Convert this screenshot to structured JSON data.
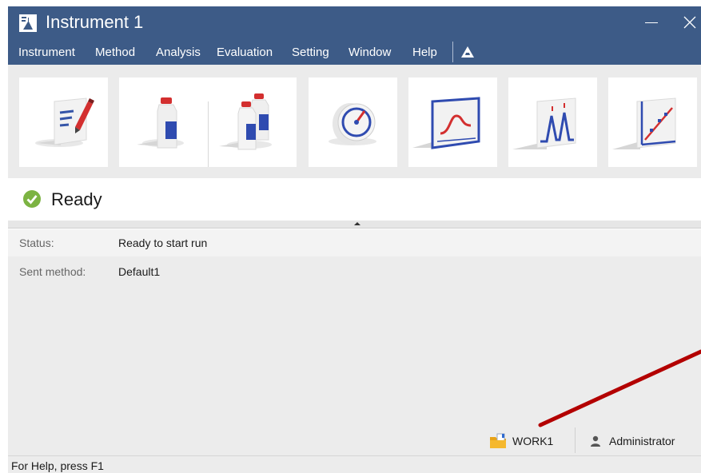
{
  "window": {
    "title": "Instrument 1"
  },
  "menu": {
    "items": [
      "Instrument",
      "Method",
      "Analysis",
      "Evaluation",
      "Setting",
      "Window",
      "Help"
    ]
  },
  "toolbar": {
    "buttons": [
      {
        "icon": "edit-document-icon"
      },
      {
        "icon": "single-sample-bottle-icon"
      },
      {
        "icon": "batch-bottles-icon"
      },
      {
        "icon": "gauge-icon"
      },
      {
        "icon": "data-monitor-icon"
      },
      {
        "icon": "chromatogram-peaks-icon"
      },
      {
        "icon": "calibration-curve-icon"
      }
    ]
  },
  "status": {
    "state": "Ready",
    "rows": [
      {
        "label": "Status:",
        "value": "Ready to start run"
      },
      {
        "label": "Sent method:",
        "value": "Default1"
      }
    ]
  },
  "footer": {
    "workspace": "WORK1",
    "user": "Administrator"
  },
  "statusbar": {
    "help_text": "For Help, press F1"
  },
  "colors": {
    "titlebar": "#3d5b87",
    "ready": "#7cb342",
    "annotation": "#b30000"
  }
}
